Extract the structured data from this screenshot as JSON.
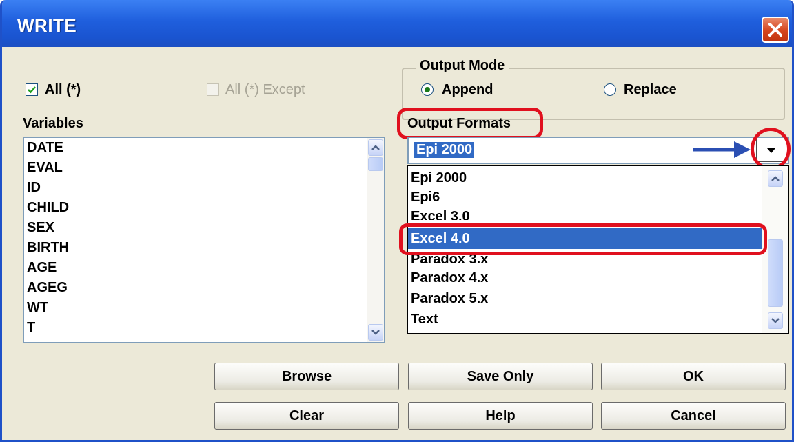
{
  "window": {
    "title": "WRITE"
  },
  "colors": {
    "title_bar": "#1f5fdd",
    "selection": "#316ac5",
    "highlight_ring": "#e0101e",
    "arrow": "#2b4fb3"
  },
  "icons": {
    "close": "close-icon",
    "dropdown": "chevron-down-icon",
    "arrow": "arrow-right-icon"
  },
  "all_checkbox": {
    "label": "All (*)",
    "checked": true
  },
  "all_except_checkbox": {
    "label": "All (*) Except",
    "checked": false,
    "enabled": false
  },
  "variables": {
    "label": "Variables",
    "items": [
      "DATE",
      "EVAL",
      "ID",
      "CHILD",
      "SEX",
      "BIRTH",
      "AGE",
      "AGEG",
      "WT",
      "T"
    ]
  },
  "output_mode": {
    "label": "Output Mode",
    "options": [
      {
        "label": "Append",
        "selected": true
      },
      {
        "label": "Replace",
        "selected": false
      }
    ]
  },
  "output_formats": {
    "label": "Output Formats",
    "selected": "Epi 2000",
    "items": [
      "Epi 2000",
      "Epi6",
      "Excel 3.0",
      "Excel 4.0",
      "Paradox 3.x",
      "Paradox 4.x",
      "Paradox 5.x",
      "Text"
    ],
    "highlighted_item": "Excel 4.0"
  },
  "buttons": {
    "browse": "Browse",
    "save_only": "Save Only",
    "ok": "OK",
    "clear": "Clear",
    "help": "Help",
    "cancel": "Cancel"
  }
}
